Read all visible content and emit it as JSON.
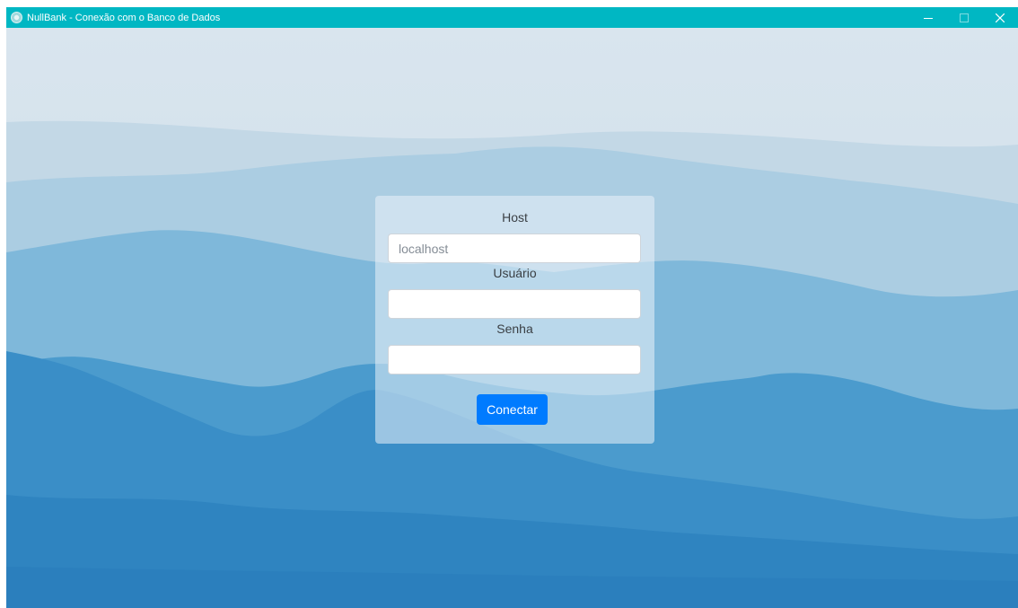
{
  "window": {
    "title": "NullBank - Conexão com o Banco de Dados",
    "controls": [
      "minimize",
      "maximize",
      "close"
    ]
  },
  "form": {
    "host_label": "Host",
    "host_placeholder": "localhost",
    "host_value": "",
    "user_label": "Usuário",
    "user_value": "",
    "password_label": "Senha",
    "password_value": "",
    "connect_label": "Conectar"
  },
  "icons": {
    "app": "app-icon",
    "minimize": "minimize-icon",
    "maximize": "maximize-icon",
    "close": "close-icon"
  },
  "colors": {
    "titlebar": "#00b7c3",
    "primary_button": "#007bff",
    "sky": "#dbe7ef",
    "mountain_dark": "#2a83c0"
  }
}
